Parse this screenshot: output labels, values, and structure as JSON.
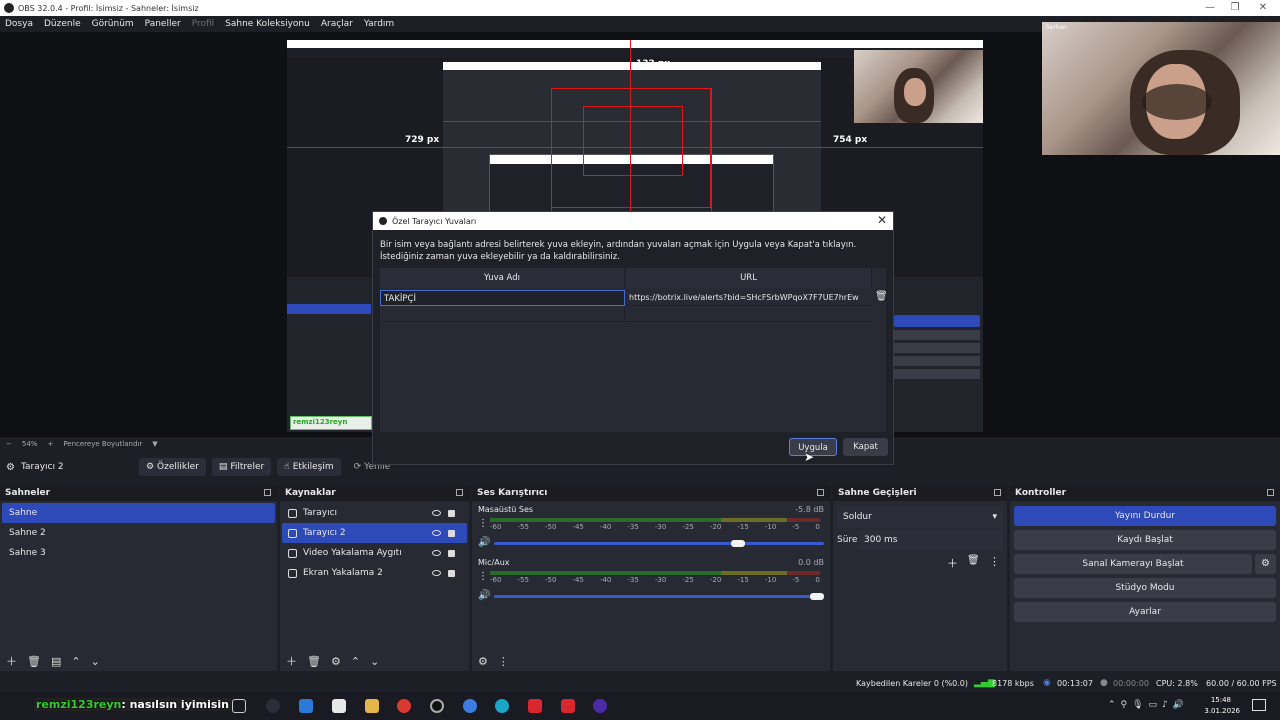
{
  "window": {
    "title": "OBS 32.0.4 - Profil: İsimsiz - Sahneler: İsimsiz"
  },
  "menu": {
    "items": [
      "Dosya",
      "Düzenle",
      "Görünüm",
      "Paneller",
      "Profil",
      "Sahne Koleksiyonu",
      "Araçlar",
      "Yardım"
    ]
  },
  "preview": {
    "measure_top": "132 px",
    "measure_left": "729 px",
    "measure_right": "754 px",
    "cam_label": "Serkan"
  },
  "zoom": {
    "minus": "−",
    "level": "54%",
    "plus": "+",
    "mode": "Pencereye Boyutlandır"
  },
  "source_toolbar": {
    "selected": "Tarayıcı 2",
    "properties": "Özellikler",
    "filters": "Filtreler",
    "interact": "Etkileşim",
    "refresh": "Yenile"
  },
  "scenes": {
    "header": "Sahneler",
    "items": [
      "Sahne",
      "Sahne 2",
      "Sahne 3"
    ]
  },
  "sources": {
    "header": "Kaynaklar",
    "items": [
      "Tarayıcı",
      "Tarayıcı 2",
      "Video Yakalama Aygıtı",
      "Ekran Yakalama 2"
    ]
  },
  "mixer": {
    "header": "Ses Karıştırıcı",
    "channels": [
      {
        "name": "Masaüstü Ses",
        "db": "-5.8 dB",
        "volume": 0.75
      },
      {
        "name": "Mic/Aux",
        "db": "0.0 dB",
        "volume": 1.0
      }
    ],
    "ticks": [
      "-60",
      "-55",
      "-50",
      "-45",
      "-40",
      "-35",
      "-30",
      "-25",
      "-20",
      "-15",
      "-10",
      "-5",
      "0"
    ]
  },
  "transitions": {
    "header": "Sahne Geçişleri",
    "type": "Soldur",
    "duration_label": "Süre",
    "duration": "300 ms"
  },
  "controls": {
    "header": "Kontroller",
    "buttons": [
      "Yayını Durdur",
      "Kaydı Başlat",
      "Sanal Kamerayı Başlat",
      "Stüdyo Modu",
      "Ayarlar"
    ]
  },
  "status": {
    "dropped": "Kaybedilen Kareler 0 (%0.0)",
    "bitrate": "8178 kbps",
    "stream_time": "00:13:07",
    "rec_time": "00:00:00",
    "cpu": "CPU: 2.8%",
    "fps": "60.00 / 60.00 FPS"
  },
  "dialog": {
    "title": "Özel Tarayıcı Yuvaları",
    "description": "Bir isim veya bağlantı adresi belirterek yuva ekleyin, ardından yuvaları açmak için Uygula veya Kapat'a tıklayın. İstediğiniz zaman yuva ekleyebilir ya da kaldırabilirsiniz.",
    "col_name": "Yuva Adı",
    "col_url": "URL",
    "rows": [
      {
        "name": "TAKİPÇİ",
        "url": "https://botrix.live/alerts?bid=SHcFSrbWPqoX7F7UE7hrEw"
      }
    ],
    "apply": "Uygula",
    "close": "Kapat"
  },
  "chat_overlay": {
    "user": "remzi123reyn",
    "message": ": nasılsın iyimisin"
  },
  "clock": {
    "time": "15:48",
    "date": "3.01.2026"
  },
  "colors": {
    "accent": "#2e49b8",
    "measure_red": "#e01515",
    "meter_green": "#2a6b2a"
  }
}
